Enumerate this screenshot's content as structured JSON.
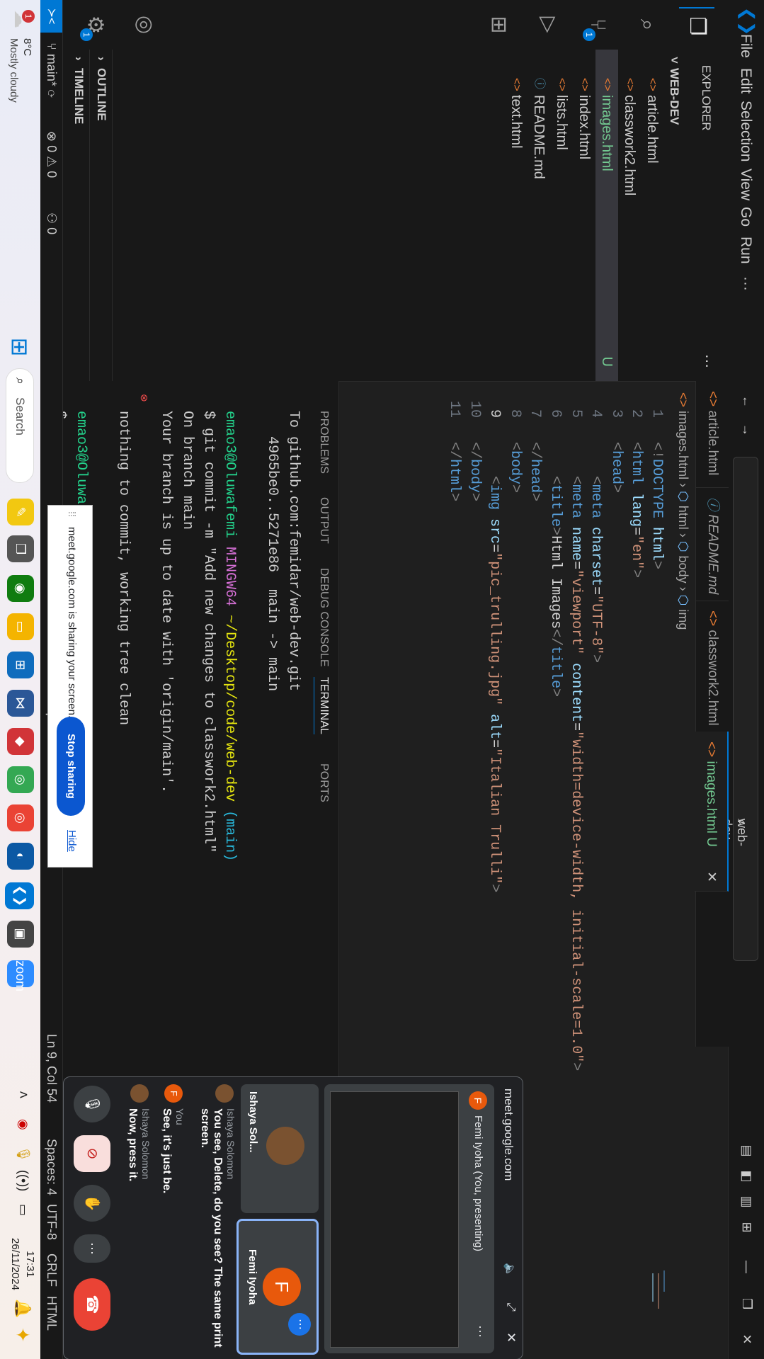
{
  "menu": {
    "file": "File",
    "edit": "Edit",
    "selection": "Selection",
    "view": "View",
    "go": "Go",
    "run": "Run",
    "more": "···"
  },
  "search": {
    "text": "web-dev"
  },
  "explorer": {
    "title": "EXPLORER",
    "folder": "WEB-DEV",
    "files": [
      {
        "name": "article.html",
        "status": ""
      },
      {
        "name": "classwork2.html",
        "status": ""
      },
      {
        "name": "images.html",
        "status": "U"
      },
      {
        "name": "index.html",
        "status": ""
      },
      {
        "name": "lists.html",
        "status": ""
      },
      {
        "name": "README.md",
        "status": ""
      },
      {
        "name": "text.html",
        "status": ""
      }
    ],
    "outline": "OUTLINE",
    "timeline": "TIMELINE"
  },
  "activity_badges": {
    "scm": "1",
    "settings": "1"
  },
  "tabs": [
    {
      "label": "article.html",
      "active": false
    },
    {
      "label": "README.md",
      "active": false
    },
    {
      "label": "classwork2.html",
      "active": false
    },
    {
      "label": "images.html U",
      "active": true
    }
  ],
  "breadcrumb": {
    "file": "images.html",
    "html": "html",
    "body": "body",
    "img": "img"
  },
  "code_lines": [
    {
      "n": "1",
      "text": "<!DOCTYPE html>"
    },
    {
      "n": "2",
      "text": "<html lang=\"en\">"
    },
    {
      "n": "3",
      "text": "<head>"
    },
    {
      "n": "4",
      "text": "    <meta charset=\"UTF-8\">"
    },
    {
      "n": "5",
      "text": "    <meta name=\"viewport\" content=\"width=device-width, initial-scale=1.0\">"
    },
    {
      "n": "6",
      "text": "    <title>Html Images</title>"
    },
    {
      "n": "7",
      "text": "</head>"
    },
    {
      "n": "8",
      "text": "<body>"
    },
    {
      "n": "9",
      "text": "    <img src=\"pic_trulling.jpg\" alt=\"Italian Trulli\">"
    },
    {
      "n": "10",
      "text": "</body>"
    },
    {
      "n": "11",
      "text": "</html>"
    }
  ],
  "panel": {
    "tabs": [
      "PROBLEMS",
      "OUTPUT",
      "DEBUG CONSOLE",
      "TERMINAL",
      "PORTS"
    ],
    "active_tab": "TERMINAL",
    "terminal": [
      "To github.com:femidar/web-dev.git",
      "   4965be0..5271e86  main -> main",
      "",
      "emao3@Oluwafemi MINGW64 ~/Desktop/code/web-dev (main)",
      "$ git commit -m \"Add new changes to classwork2.html\"",
      "On branch main",
      "Your branch is up to date with 'origin/main'.",
      "",
      "nothing to commit, working tree clean",
      "",
      "emao3@Oluwafemi MINGW64 ~/Desktop/code/web-dev (main)",
      "$ "
    ]
  },
  "status": {
    "branch": "main*",
    "errors": "0",
    "warnings": "0",
    "ports": "0",
    "position": "Ln 9, Col 54",
    "spaces": "Spaces: 4",
    "encoding": "UTF-8",
    "eol": "CRLF",
    "language": "HTML"
  },
  "taskbar": {
    "weather_temp": "8°C",
    "weather_desc": "Mostly cloudy",
    "search": "Search",
    "time": "17:31",
    "date": "26/11/2024",
    "weather_badge": "1"
  },
  "meet": {
    "site": "meet.google.com",
    "presenter": "Femi Iyoha (You, presenting)",
    "tile1": "Ishaya Sol...",
    "tile2": "Femi Iyoha",
    "avatar_letter": "F",
    "chat": [
      {
        "name": "Ishaya Solomon",
        "text": "You see, Delete, do you see? The same print screen."
      },
      {
        "name": "You",
        "text": "See, it's just be."
      },
      {
        "name": "Ishaya Solomon",
        "text": "Now, press it."
      }
    ]
  },
  "sharebar": {
    "text": "meet.google.com is sharing your screen.",
    "stop": "Stop sharing",
    "hide": "Hide"
  },
  "colors": {
    "accent": "#0078d4",
    "untracked": "#73c991",
    "end_call": "#ea4335",
    "share_btn": "#0b57d0"
  }
}
